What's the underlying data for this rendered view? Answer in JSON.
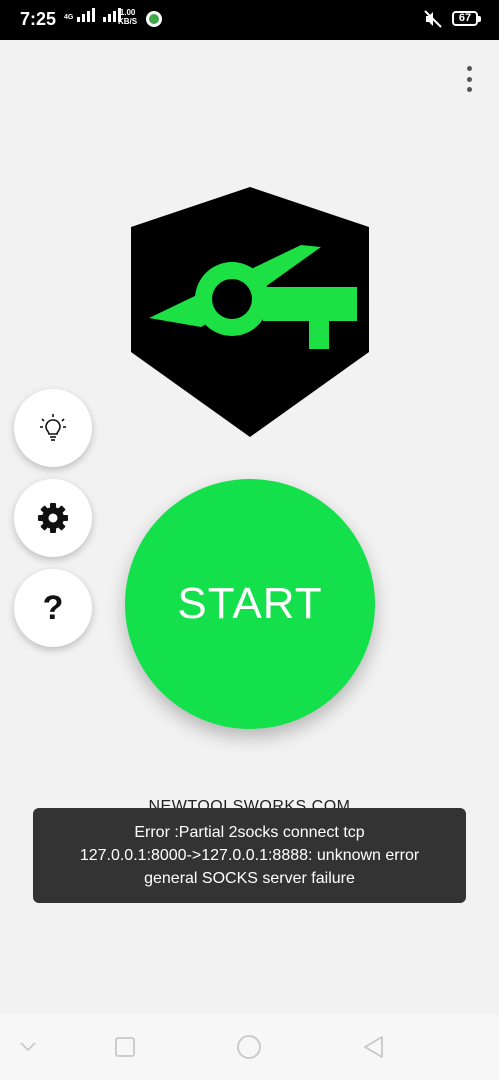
{
  "status_bar": {
    "time": "7:25",
    "network_type": "4G",
    "speed_value": "1.00",
    "speed_unit": "KB/S",
    "battery": "67"
  },
  "app": {
    "brand": "NEWTOOLSWORKS.COM",
    "start_label": "START",
    "help_label": "?",
    "logo_colors": {
      "shield": "#000000",
      "mark": "#1ce044"
    }
  },
  "toast": {
    "line1": "Error :Partial 2socks connect tcp",
    "line2": "127.0.0.1:8000->127.0.0.1:8888: unknown error",
    "line3": "general SOCKS server failure"
  },
  "icons": [
    "lightbulb-icon",
    "gear-icon",
    "overflow-menu-icon",
    "back-icon",
    "home-icon",
    "recents-icon",
    "collapse-icon"
  ],
  "colors": {
    "accent": "#13e04a",
    "background": "#f2f2f2",
    "toast_bg": "#333333"
  }
}
